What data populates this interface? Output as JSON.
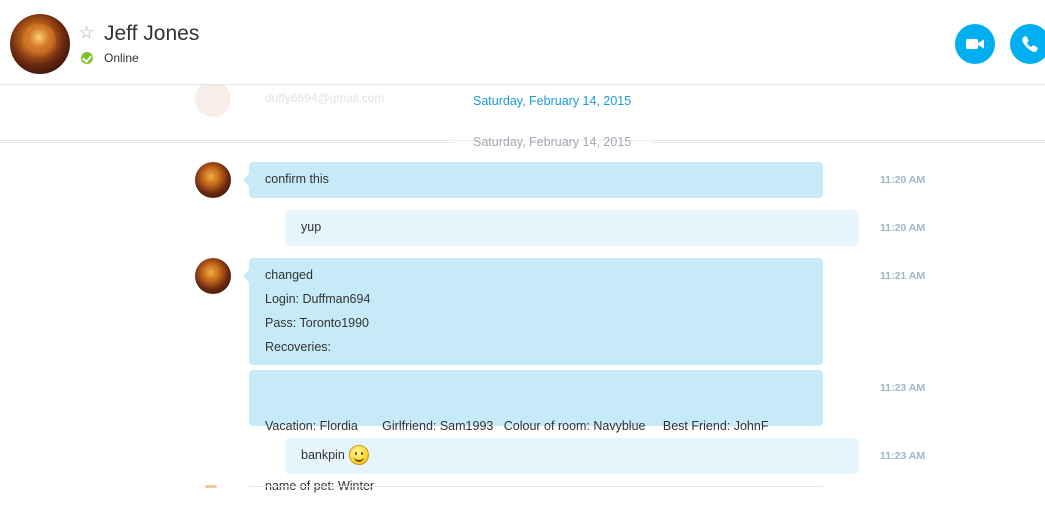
{
  "header": {
    "contact_name": "Jeff Jones",
    "presence": "Online",
    "presence_color": "#7cc42a",
    "favorite_icon": "star-outline-icon",
    "video_call_icon": "video-camera-icon",
    "audio_call_icon": "phone-icon",
    "accent_color": "#00aff0"
  },
  "previous": {
    "email": "duffy6694@gmail.com",
    "sticky_date": "Saturday, February 14, 2015"
  },
  "divider": {
    "date": "Saturday, February 14, 2015"
  },
  "messages": [
    {
      "direction": "in",
      "lines": [
        "confirm this"
      ],
      "time": "11:20 AM"
    },
    {
      "direction": "out",
      "lines": [
        "yup"
      ],
      "time": "11:20 AM"
    },
    {
      "direction": "in",
      "lines": [
        "changed",
        "Login: Duffman694",
        "Pass: Toronto1990",
        "Recoveries:"
      ],
      "time": "11:21 AM"
    },
    {
      "direction": "in",
      "lines": [
        "Vacation: Flordia       Girlfriend: Sam1993   Colour of room: Navyblue     Best Friend: JohnF",
        "name of pet: Winter"
      ],
      "time": "11:23 AM"
    },
    {
      "direction": "out",
      "lines": [
        "bankpin"
      ],
      "emoji": "smiley-emoji-icon",
      "time": "11:23 AM"
    }
  ]
}
